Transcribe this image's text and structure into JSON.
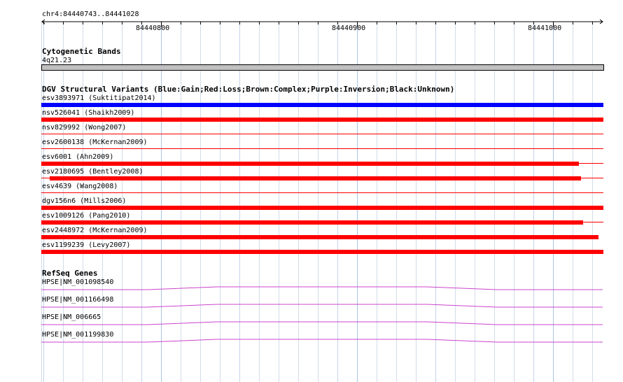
{
  "location": {
    "label": "chr4:84440743..84441028"
  },
  "ruler": {
    "ticks": [
      "84440800",
      "84440900",
      "84441000"
    ]
  },
  "colors": {
    "gain": "#0000ff",
    "loss": "#ff0000",
    "row_divider": "#ff0000",
    "gene": "#cc44cc",
    "band_fill": "#c0c0c0",
    "grid_major": "#a9c4e6",
    "grid_minor": "#d2dcea"
  },
  "cytoband": {
    "title": "Cytogenetic Bands",
    "band_label": "4q21.23"
  },
  "dgv": {
    "title": "DGV Structural Variants (Blue:Gain;Red:Loss;Brown:Complex;Purple:Inversion;Black:Unknown)",
    "variants": [
      {
        "label": "esv3893971 (Suktitipat2014)",
        "type": "gain",
        "bar": true
      },
      {
        "label": "nsv526041 (Shaikh2009)",
        "type": "loss",
        "bar": true
      },
      {
        "label": "nsv829992 (Wong2007)",
        "type": "loss",
        "bar": false
      },
      {
        "label": "esv2600138 (McKernan2009)",
        "type": "loss",
        "bar": false
      },
      {
        "label": "esv6001 (Ahn2009)",
        "type": "loss",
        "bar": true
      },
      {
        "label": "esv2180695 (Bentley2008)",
        "type": "loss",
        "bar": true
      },
      {
        "label": "esv4639 (Wang2008)",
        "type": "loss",
        "bar": false
      },
      {
        "label": "dgv156n6 (Mills2006)",
        "type": "loss",
        "bar": true
      },
      {
        "label": "esv1009126 (Pang2010)",
        "type": "loss",
        "bar": true
      },
      {
        "label": "esv2448972 (McKernan2009)",
        "type": "loss",
        "bar": true
      },
      {
        "label": "esv1199239 (Levy2007)",
        "type": "loss",
        "bar": true
      }
    ]
  },
  "refseq": {
    "title": "RefSeq Genes",
    "genes": [
      {
        "label": "HPSE|NM_001098540"
      },
      {
        "label": "HPSE|NM_001166498"
      },
      {
        "label": "HPSE|NM_006665"
      },
      {
        "label": "HPSE|NM_001199830"
      }
    ]
  }
}
